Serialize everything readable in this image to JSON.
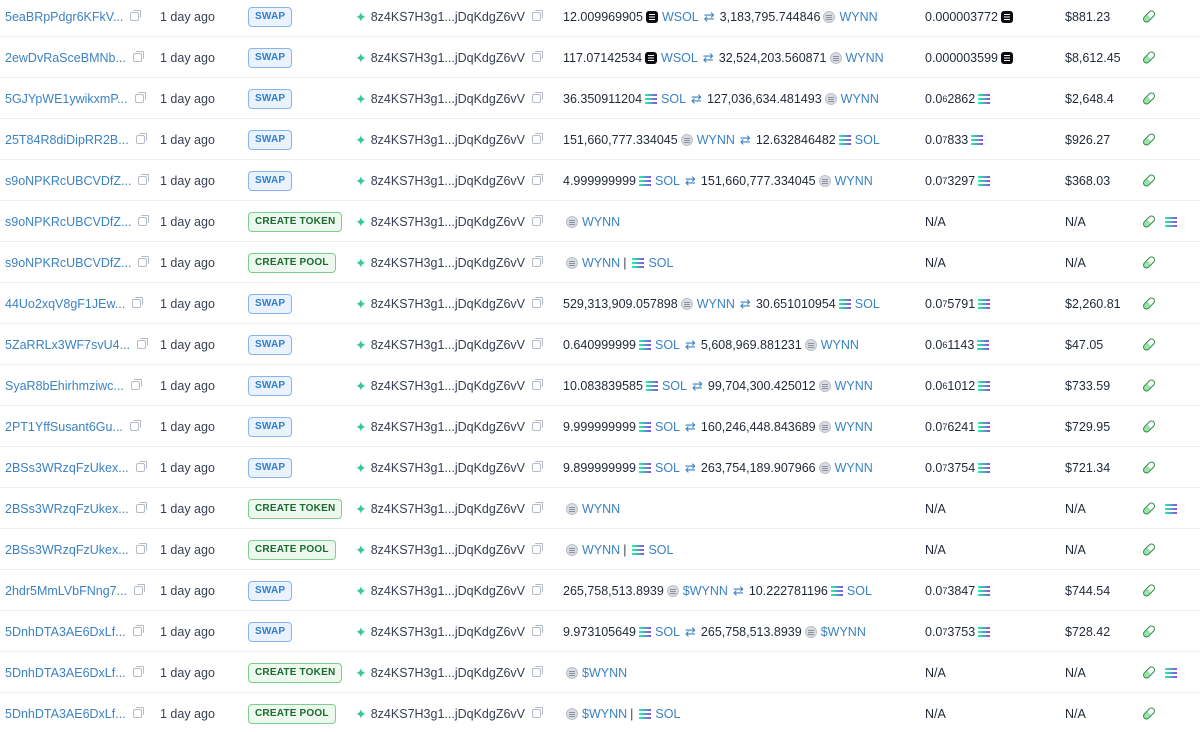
{
  "rows": [
    {
      "sig": "5eaBRpPdgr6KFkV...",
      "time": "1 day ago",
      "type": "SWAP",
      "by": "8z4KS7H3g1...jDqKdgZ6vV",
      "amount": [
        {
          "t": "n",
          "v": "12.009969905"
        },
        {
          "t": "i",
          "v": "wsol-icon"
        },
        {
          "t": "k",
          "v": "WSOL"
        },
        {
          "t": "s"
        },
        {
          "t": "n",
          "v": "3,183,795.744846"
        },
        {
          "t": "i",
          "v": "wynn-icon"
        },
        {
          "t": "k",
          "v": "WYNN"
        }
      ],
      "price": [
        {
          "t": "n",
          "v": "0.000003772"
        },
        {
          "t": "i",
          "v": "wsol-icon"
        }
      ],
      "value": "$881.23",
      "prog": [
        "pill-icon"
      ]
    },
    {
      "sig": "2ewDvRaSceBMNb...",
      "time": "1 day ago",
      "type": "SWAP",
      "by": "8z4KS7H3g1...jDqKdgZ6vV",
      "amount": [
        {
          "t": "n",
          "v": "117.07142534"
        },
        {
          "t": "i",
          "v": "wsol-icon"
        },
        {
          "t": "k",
          "v": "WSOL"
        },
        {
          "t": "s"
        },
        {
          "t": "n",
          "v": "32,524,203.560871"
        },
        {
          "t": "i",
          "v": "wynn-icon"
        },
        {
          "t": "k",
          "v": "WYNN"
        }
      ],
      "price": [
        {
          "t": "n",
          "v": "0.000003599"
        },
        {
          "t": "i",
          "v": "wsol-icon"
        }
      ],
      "value": "$8,612.45",
      "prog": [
        "pill-icon"
      ]
    },
    {
      "sig": "5GJYpWE1ywikxmP...",
      "time": "1 day ago",
      "type": "SWAP",
      "by": "8z4KS7H3g1...jDqKdgZ6vV",
      "amount": [
        {
          "t": "n",
          "v": "36.350911204"
        },
        {
          "t": "i",
          "v": "sol-icon"
        },
        {
          "t": "k",
          "v": "SOL"
        },
        {
          "t": "s"
        },
        {
          "t": "n",
          "v": "127,036,634.481493"
        },
        {
          "t": "i",
          "v": "wynn-icon"
        },
        {
          "t": "k",
          "v": "WYNN"
        }
      ],
      "price": [
        {
          "t": "n",
          "v": "0.0"
        },
        {
          "t": "u",
          "v": "6"
        },
        {
          "t": "n",
          "v": "2862"
        },
        {
          "t": "i",
          "v": "sol-icon"
        }
      ],
      "value": "$2,648.4",
      "prog": [
        "pill-icon"
      ]
    },
    {
      "sig": "25T84R8diDipRR2B...",
      "time": "1 day ago",
      "type": "SWAP",
      "by": "8z4KS7H3g1...jDqKdgZ6vV",
      "amount": [
        {
          "t": "n",
          "v": "151,660,777.334045"
        },
        {
          "t": "i",
          "v": "wynn-icon"
        },
        {
          "t": "k",
          "v": "WYNN"
        },
        {
          "t": "s"
        },
        {
          "t": "n",
          "v": "12.632846482"
        },
        {
          "t": "i",
          "v": "sol-icon"
        },
        {
          "t": "k",
          "v": "SOL"
        }
      ],
      "price": [
        {
          "t": "n",
          "v": "0.0"
        },
        {
          "t": "u",
          "v": "7"
        },
        {
          "t": "n",
          "v": "833"
        },
        {
          "t": "i",
          "v": "sol-icon"
        }
      ],
      "value": "$926.27",
      "prog": [
        "pill-icon"
      ]
    },
    {
      "sig": "s9oNPKRcUBCVDfZ...",
      "time": "1 day ago",
      "type": "SWAP",
      "by": "8z4KS7H3g1...jDqKdgZ6vV",
      "amount": [
        {
          "t": "n",
          "v": "4.999999999"
        },
        {
          "t": "i",
          "v": "sol-icon"
        },
        {
          "t": "k",
          "v": "SOL"
        },
        {
          "t": "s"
        },
        {
          "t": "n",
          "v": "151,660,777.334045"
        },
        {
          "t": "i",
          "v": "wynn-icon"
        },
        {
          "t": "k",
          "v": "WYNN"
        }
      ],
      "price": [
        {
          "t": "n",
          "v": "0.0"
        },
        {
          "t": "u",
          "v": "7"
        },
        {
          "t": "n",
          "v": "3297"
        },
        {
          "t": "i",
          "v": "sol-icon"
        }
      ],
      "value": "$368.03",
      "prog": [
        "pill-icon"
      ]
    },
    {
      "sig": "s9oNPKRcUBCVDfZ...",
      "time": "1 day ago",
      "type": "CREATE TOKEN",
      "by": "8z4KS7H3g1...jDqKdgZ6vV",
      "amount": [
        {
          "t": "i",
          "v": "wynn-icon"
        },
        {
          "t": "k",
          "v": "WYNN"
        }
      ],
      "price": [
        {
          "t": "n",
          "v": "N/A"
        }
      ],
      "value": "N/A",
      "prog": [
        "pill-icon",
        "sol-icon"
      ]
    },
    {
      "sig": "s9oNPKRcUBCVDfZ...",
      "time": "1 day ago",
      "type": "CREATE POOL",
      "by": "8z4KS7H3g1...jDqKdgZ6vV",
      "amount": [
        {
          "t": "i",
          "v": "wynn-icon"
        },
        {
          "t": "k",
          "v": "WYNN"
        },
        {
          "t": "p",
          "v": "|"
        },
        {
          "t": "i",
          "v": "sol-icon"
        },
        {
          "t": "k",
          "v": "SOL"
        }
      ],
      "price": [
        {
          "t": "n",
          "v": "N/A"
        }
      ],
      "value": "N/A",
      "prog": [
        "pill-icon"
      ]
    },
    {
      "sig": "44Uo2xqV8gF1JEw...",
      "time": "1 day ago",
      "type": "SWAP",
      "by": "8z4KS7H3g1...jDqKdgZ6vV",
      "amount": [
        {
          "t": "n",
          "v": "529,313,909.057898"
        },
        {
          "t": "i",
          "v": "wynn-icon"
        },
        {
          "t": "k",
          "v": "WYNN"
        },
        {
          "t": "s"
        },
        {
          "t": "n",
          "v": "30.651010954"
        },
        {
          "t": "i",
          "v": "sol-icon"
        },
        {
          "t": "k",
          "v": "SOL"
        }
      ],
      "price": [
        {
          "t": "n",
          "v": "0.0"
        },
        {
          "t": "u",
          "v": "7"
        },
        {
          "t": "n",
          "v": "5791"
        },
        {
          "t": "i",
          "v": "sol-icon"
        }
      ],
      "value": "$2,260.81",
      "prog": [
        "pill-icon"
      ]
    },
    {
      "sig": "5ZaRRLx3WF7svU4...",
      "time": "1 day ago",
      "type": "SWAP",
      "by": "8z4KS7H3g1...jDqKdgZ6vV",
      "amount": [
        {
          "t": "n",
          "v": "0.640999999"
        },
        {
          "t": "i",
          "v": "sol-icon"
        },
        {
          "t": "k",
          "v": "SOL"
        },
        {
          "t": "s"
        },
        {
          "t": "n",
          "v": "5,608,969.881231"
        },
        {
          "t": "i",
          "v": "wynn-icon"
        },
        {
          "t": "k",
          "v": "WYNN"
        }
      ],
      "price": [
        {
          "t": "n",
          "v": "0.0"
        },
        {
          "t": "u",
          "v": "6"
        },
        {
          "t": "n",
          "v": "1143"
        },
        {
          "t": "i",
          "v": "sol-icon"
        }
      ],
      "value": "$47.05",
      "prog": [
        "pill-icon"
      ]
    },
    {
      "sig": "SyaR8bEhirhmziwc...",
      "time": "1 day ago",
      "type": "SWAP",
      "by": "8z4KS7H3g1...jDqKdgZ6vV",
      "amount": [
        {
          "t": "n",
          "v": "10.083839585"
        },
        {
          "t": "i",
          "v": "sol-icon"
        },
        {
          "t": "k",
          "v": "SOL"
        },
        {
          "t": "s"
        },
        {
          "t": "n",
          "v": "99,704,300.425012"
        },
        {
          "t": "i",
          "v": "wynn-icon"
        },
        {
          "t": "k",
          "v": "WYNN"
        }
      ],
      "price": [
        {
          "t": "n",
          "v": "0.0"
        },
        {
          "t": "u",
          "v": "6"
        },
        {
          "t": "n",
          "v": "1012"
        },
        {
          "t": "i",
          "v": "sol-icon"
        }
      ],
      "value": "$733.59",
      "prog": [
        "pill-icon"
      ]
    },
    {
      "sig": "2PT1YffSusant6Gu...",
      "time": "1 day ago",
      "type": "SWAP",
      "by": "8z4KS7H3g1...jDqKdgZ6vV",
      "amount": [
        {
          "t": "n",
          "v": "9.999999999"
        },
        {
          "t": "i",
          "v": "sol-icon"
        },
        {
          "t": "k",
          "v": "SOL"
        },
        {
          "t": "s"
        },
        {
          "t": "n",
          "v": "160,246,448.843689"
        },
        {
          "t": "i",
          "v": "wynn-icon"
        },
        {
          "t": "k",
          "v": "WYNN"
        }
      ],
      "price": [
        {
          "t": "n",
          "v": "0.0"
        },
        {
          "t": "u",
          "v": "7"
        },
        {
          "t": "n",
          "v": "6241"
        },
        {
          "t": "i",
          "v": "sol-icon"
        }
      ],
      "value": "$729.95",
      "prog": [
        "pill-icon"
      ]
    },
    {
      "sig": "2BSs3WRzqFzUkex...",
      "time": "1 day ago",
      "type": "SWAP",
      "by": "8z4KS7H3g1...jDqKdgZ6vV",
      "amount": [
        {
          "t": "n",
          "v": "9.899999999"
        },
        {
          "t": "i",
          "v": "sol-icon"
        },
        {
          "t": "k",
          "v": "SOL"
        },
        {
          "t": "s"
        },
        {
          "t": "n",
          "v": "263,754,189.907966"
        },
        {
          "t": "i",
          "v": "wynn-icon"
        },
        {
          "t": "k",
          "v": "WYNN"
        }
      ],
      "price": [
        {
          "t": "n",
          "v": "0.0"
        },
        {
          "t": "u",
          "v": "7"
        },
        {
          "t": "n",
          "v": "3754"
        },
        {
          "t": "i",
          "v": "sol-icon"
        }
      ],
      "value": "$721.34",
      "prog": [
        "pill-icon"
      ]
    },
    {
      "sig": "2BSs3WRzqFzUkex...",
      "time": "1 day ago",
      "type": "CREATE TOKEN",
      "by": "8z4KS7H3g1...jDqKdgZ6vV",
      "amount": [
        {
          "t": "i",
          "v": "wynn-icon"
        },
        {
          "t": "k",
          "v": "WYNN"
        }
      ],
      "price": [
        {
          "t": "n",
          "v": "N/A"
        }
      ],
      "value": "N/A",
      "prog": [
        "pill-icon",
        "sol-icon"
      ]
    },
    {
      "sig": "2BSs3WRzqFzUkex...",
      "time": "1 day ago",
      "type": "CREATE POOL",
      "by": "8z4KS7H3g1...jDqKdgZ6vV",
      "amount": [
        {
          "t": "i",
          "v": "wynn-icon"
        },
        {
          "t": "k",
          "v": "WYNN"
        },
        {
          "t": "p",
          "v": "|"
        },
        {
          "t": "i",
          "v": "sol-icon"
        },
        {
          "t": "k",
          "v": "SOL"
        }
      ],
      "price": [
        {
          "t": "n",
          "v": "N/A"
        }
      ],
      "value": "N/A",
      "prog": [
        "pill-icon"
      ]
    },
    {
      "sig": "2hdr5MmLVbFNng7...",
      "time": "1 day ago",
      "type": "SWAP",
      "by": "8z4KS7H3g1...jDqKdgZ6vV",
      "amount": [
        {
          "t": "n",
          "v": "265,758,513.8939"
        },
        {
          "t": "i",
          "v": "wynn-icon"
        },
        {
          "t": "k",
          "v": "$WYNN"
        },
        {
          "t": "s"
        },
        {
          "t": "n",
          "v": "10.222781196"
        },
        {
          "t": "i",
          "v": "sol-icon"
        },
        {
          "t": "k",
          "v": "SOL"
        }
      ],
      "price": [
        {
          "t": "n",
          "v": "0.0"
        },
        {
          "t": "u",
          "v": "7"
        },
        {
          "t": "n",
          "v": "3847"
        },
        {
          "t": "i",
          "v": "sol-icon"
        }
      ],
      "value": "$744.54",
      "prog": [
        "pill-icon"
      ]
    },
    {
      "sig": "5DnhDTA3AE6DxLf...",
      "time": "1 day ago",
      "type": "SWAP",
      "by": "8z4KS7H3g1...jDqKdgZ6vV",
      "amount": [
        {
          "t": "n",
          "v": "9.973105649"
        },
        {
          "t": "i",
          "v": "sol-icon"
        },
        {
          "t": "k",
          "v": "SOL"
        },
        {
          "t": "s"
        },
        {
          "t": "n",
          "v": "265,758,513.8939"
        },
        {
          "t": "i",
          "v": "wynn-icon"
        },
        {
          "t": "k",
          "v": "$WYNN"
        }
      ],
      "price": [
        {
          "t": "n",
          "v": "0.0"
        },
        {
          "t": "u",
          "v": "7"
        },
        {
          "t": "n",
          "v": "3753"
        },
        {
          "t": "i",
          "v": "sol-icon"
        }
      ],
      "value": "$728.42",
      "prog": [
        "pill-icon"
      ]
    },
    {
      "sig": "5DnhDTA3AE6DxLf...",
      "time": "1 day ago",
      "type": "CREATE TOKEN",
      "by": "8z4KS7H3g1...jDqKdgZ6vV",
      "amount": [
        {
          "t": "i",
          "v": "wynn-icon"
        },
        {
          "t": "k",
          "v": "$WYNN"
        }
      ],
      "price": [
        {
          "t": "n",
          "v": "N/A"
        }
      ],
      "value": "N/A",
      "prog": [
        "pill-icon",
        "sol-icon"
      ]
    },
    {
      "sig": "5DnhDTA3AE6DxLf...",
      "time": "1 day ago",
      "type": "CREATE POOL",
      "by": "8z4KS7H3g1...jDqKdgZ6vV",
      "amount": [
        {
          "t": "i",
          "v": "wynn-icon"
        },
        {
          "t": "k",
          "v": "$WYNN"
        },
        {
          "t": "p",
          "v": "|"
        },
        {
          "t": "i",
          "v": "sol-icon"
        },
        {
          "t": "k",
          "v": "SOL"
        }
      ],
      "price": [
        {
          "t": "n",
          "v": "N/A"
        }
      ],
      "value": "N/A",
      "prog": [
        "pill-icon"
      ]
    }
  ]
}
